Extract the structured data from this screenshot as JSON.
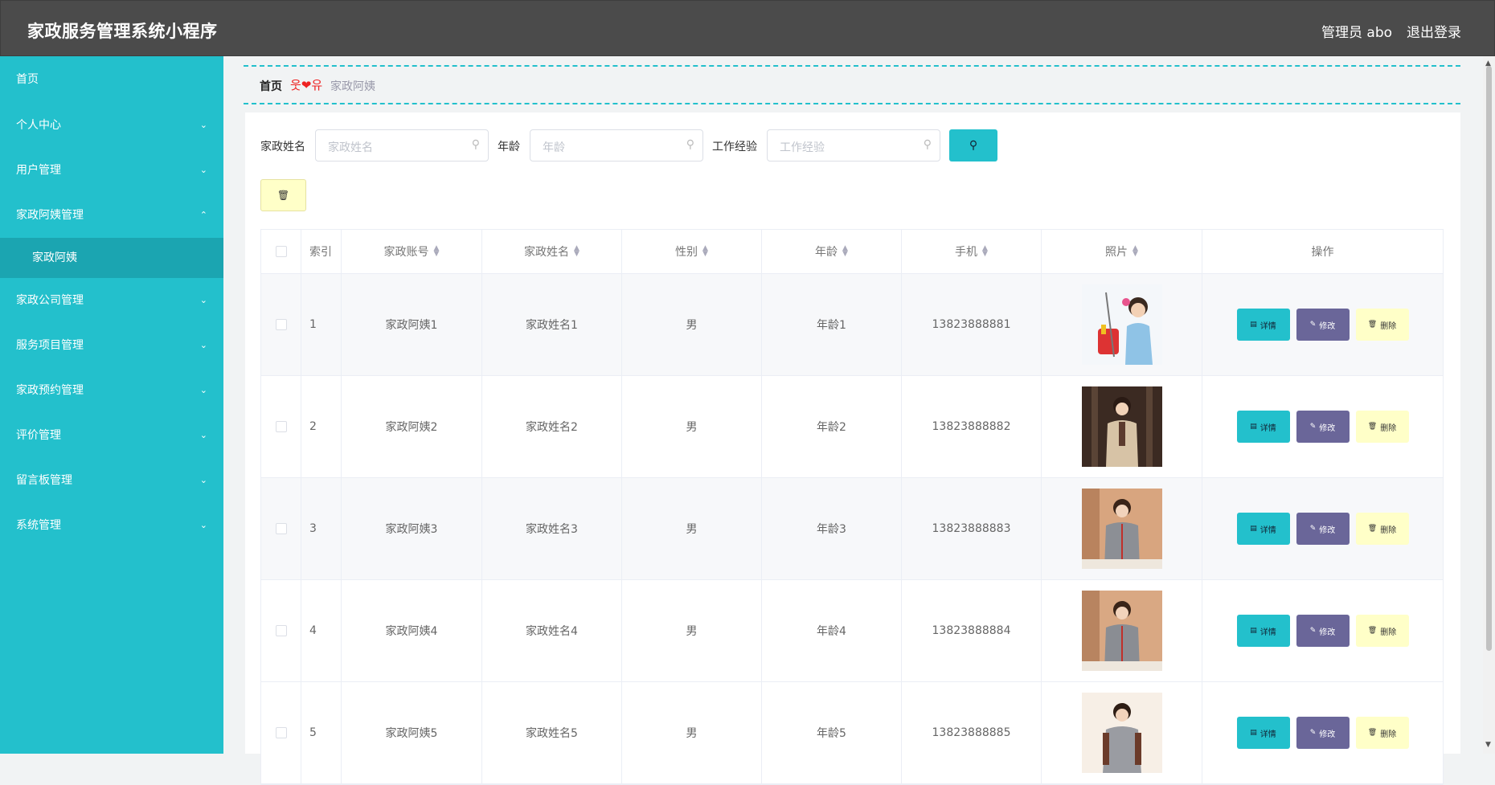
{
  "app": {
    "title": "家政服务管理系统小程序",
    "user": "管理员 abo",
    "logout": "退出登录"
  },
  "sidebar": {
    "home": "首页",
    "items": [
      {
        "label": "个人中心",
        "chev": "⌄"
      },
      {
        "label": "用户管理",
        "chev": "⌄"
      },
      {
        "label": "家政阿姨管理",
        "chev": "⌃",
        "sub": "家政阿姨"
      },
      {
        "label": "家政公司管理",
        "chev": "⌄"
      },
      {
        "label": "服务项目管理",
        "chev": "⌄"
      },
      {
        "label": "家政预约管理",
        "chev": "⌄"
      },
      {
        "label": "评价管理",
        "chev": "⌄"
      },
      {
        "label": "留言板管理",
        "chev": "⌄"
      },
      {
        "label": "系统管理",
        "chev": "⌄"
      }
    ]
  },
  "breadcrumb": {
    "home": "首页",
    "sep": "웃❤유",
    "current": "家政阿姨"
  },
  "filters": {
    "name_label": "家政姓名",
    "name_placeholder": "家政姓名",
    "age_label": "年龄",
    "age_placeholder": "年龄",
    "exp_label": "工作经验",
    "exp_placeholder": "工作经验",
    "search_icon": "search-icon"
  },
  "toolbar": {
    "delete_icon": "trash-icon"
  },
  "table": {
    "columns": [
      "索引",
      "家政账号",
      "家政姓名",
      "性别",
      "年龄",
      "手机",
      "照片",
      "操作"
    ],
    "actions": {
      "detail": "详情",
      "edit": "修改",
      "remove": "删除"
    },
    "rows": [
      {
        "index": "1",
        "account": "家政阿姨1",
        "name": "家政姓名1",
        "gender": "男",
        "age": "年龄1",
        "phone": "13823888881"
      },
      {
        "index": "2",
        "account": "家政阿姨2",
        "name": "家政姓名2",
        "gender": "男",
        "age": "年龄2",
        "phone": "13823888882"
      },
      {
        "index": "3",
        "account": "家政阿姨3",
        "name": "家政姓名3",
        "gender": "男",
        "age": "年龄3",
        "phone": "13823888883"
      },
      {
        "index": "4",
        "account": "家政阿姨4",
        "name": "家政姓名4",
        "gender": "男",
        "age": "年龄4",
        "phone": "13823888884"
      },
      {
        "index": "5",
        "account": "家政阿姨5",
        "name": "家政姓名5",
        "gender": "男",
        "age": "年龄5",
        "phone": "13823888885"
      }
    ]
  },
  "colors": {
    "topbar": "#4b4b4b",
    "sidebar": "#23c0cc",
    "sidebar_active": "#1ba5b1",
    "edit_button": "#6a6699",
    "delete_button": "#ffffc8"
  }
}
